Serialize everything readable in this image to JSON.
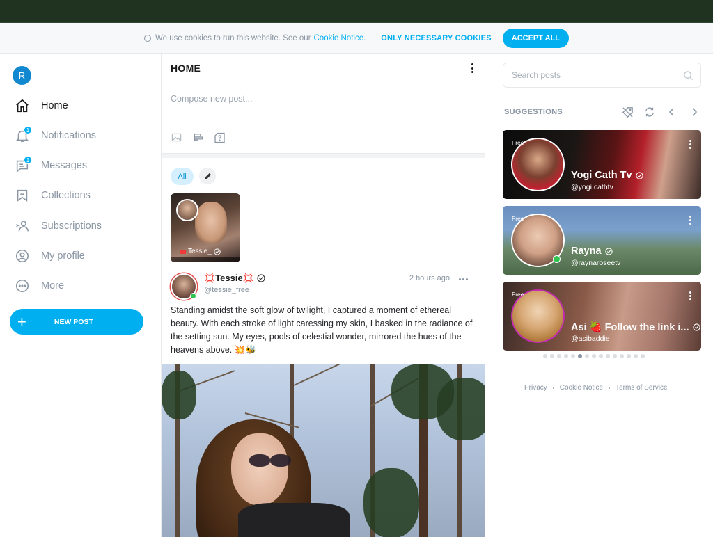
{
  "cookie": {
    "message": "We use cookies to run this website. See our",
    "notice_link": "Cookie Notice.",
    "only_necessary": "ONLY NECESSARY COOKIES",
    "accept_all": "ACCEPT ALL"
  },
  "user": {
    "initial": "R"
  },
  "nav": {
    "home": "Home",
    "notifications": "Notifications",
    "notifications_badge": "1",
    "messages": "Messages",
    "messages_badge": "1",
    "collections": "Collections",
    "subscriptions": "Subscriptions",
    "my_profile": "My profile",
    "more": "More",
    "new_post": "NEW POST"
  },
  "feed": {
    "title": "HOME",
    "compose_placeholder": "Compose new post...",
    "filter_all": "All",
    "story": {
      "name": "Tessie_"
    },
    "post": {
      "name": "💢Tessie💢",
      "handle": "@tessie_free",
      "time": "2 hours ago",
      "text": "Standing amidst the soft glow of twilight, I captured a moment of ethereal beauty. With each stroke of light caressing my skin, I basked in the radiance of the setting sun. My eyes, pools of celestial wonder, mirrored the hues of the heavens above. 💥🐝"
    }
  },
  "sidebar_right": {
    "search_placeholder": "Search posts",
    "suggestions_title": "SUGGESTIONS",
    "cards": [
      {
        "badge": "Free",
        "name": "Yogi Cath Tv",
        "handle": "@yogi.cathtv"
      },
      {
        "badge": "Free",
        "name": "Rayna",
        "handle": "@raynaroseetv"
      },
      {
        "badge": "Free",
        "name": "Asi 🍓 Follow the link i...",
        "handle": "@asibaddie"
      }
    ],
    "pagination": {
      "total": 15,
      "current": 6
    }
  },
  "footer": {
    "privacy": "Privacy",
    "cookie_notice": "Cookie Notice",
    "terms": "Terms of Service"
  },
  "colors": {
    "accent": "#00aff0",
    "online": "#31c451",
    "muted": "#8a96a3"
  }
}
